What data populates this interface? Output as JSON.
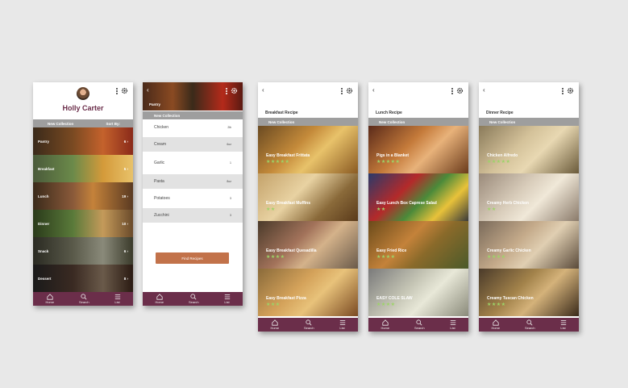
{
  "nav": {
    "home": "Home",
    "search": "Search",
    "list": "List"
  },
  "profile": {
    "name": "Holly Carter",
    "new_collection": "New Collection",
    "sort_by": "Sort By:",
    "categories": [
      {
        "label": "Pantry",
        "count": "6"
      },
      {
        "label": "Breakfast",
        "count": "5"
      },
      {
        "label": "Lunch",
        "count": "19"
      },
      {
        "label": "Dinner",
        "count": "10"
      },
      {
        "label": "Snack",
        "count": "6"
      },
      {
        "label": "Dessert",
        "count": "8"
      }
    ]
  },
  "collection": {
    "header": "Pantry",
    "new_collection": "New Collection",
    "ingredients": [
      {
        "name": "Chicken",
        "amount": "2lb"
      },
      {
        "name": "Cream",
        "amount": "6oz"
      },
      {
        "name": "Garlic",
        "amount": "1"
      },
      {
        "name": "Pasta",
        "amount": "8oz"
      },
      {
        "name": "Potatoes",
        "amount": "3"
      },
      {
        "name": "Zucchini",
        "amount": "3"
      }
    ],
    "find_button": "Find Recipes"
  },
  "breakfast": {
    "title": "Breakfast Recipe",
    "new_collection": "New Collection",
    "recipes": [
      {
        "name": "Easy Breakfast Frittata",
        "stars": "★★★★★"
      },
      {
        "name": "Easy Breakfast Muffins",
        "stars": "★★"
      },
      {
        "name": "Easy Breakfast Quesadilla",
        "stars": "★★★★"
      },
      {
        "name": "Easy Breakfast Pizza",
        "stars": "★★★"
      }
    ]
  },
  "lunch": {
    "title": "Lunch Recipe",
    "new_collection": "New Collection",
    "recipes": [
      {
        "name": "Pigs in a Blanket",
        "stars": "★★★★★"
      },
      {
        "name": "Easy Lunch Box Caprese Salad",
        "stars": "★★"
      },
      {
        "name": "Easy Fried Rice",
        "stars": "★★★★"
      },
      {
        "name": "EASY COLE SLAW",
        "stars": "★★★★"
      }
    ]
  },
  "dinner": {
    "title": "Dinner Recipe",
    "new_collection": "New Collection",
    "recipes": [
      {
        "name": "Chicken Alfredo",
        "stars": "★★★★★"
      },
      {
        "name": "Creamy Herb Chicken",
        "stars": "★★"
      },
      {
        "name": "Creamy Garlic Chicken",
        "stars": "★★★★"
      },
      {
        "name": "Creamy Tuscan Chicken",
        "stars": "★★★★"
      }
    ]
  },
  "colors": {
    "accent": "#6b2e4a",
    "button": "#c2724a",
    "star": "#9cd468",
    "bar": "#9e9e9e"
  }
}
